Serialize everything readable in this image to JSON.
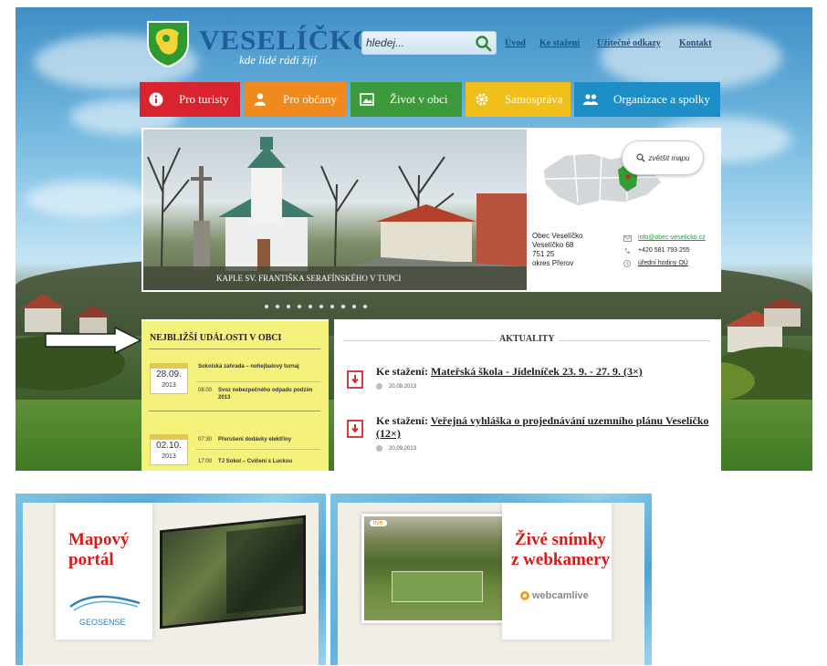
{
  "header": {
    "logo_title": "VESELÍČKO",
    "logo_slogan": "kde lidé rádi žijí",
    "search_placeholder": "hledej...",
    "top_links": [
      "Úvod",
      "Ke stažení",
      "Užitečné odkazy",
      "Kontakt"
    ]
  },
  "nav": {
    "tabs": [
      {
        "label": "Pro turisty",
        "color": "#d9232e",
        "icon": "info-icon"
      },
      {
        "label": "Pro občany",
        "color": "#f08a1c",
        "icon": "person-icon"
      },
      {
        "label": "Život v obci",
        "color": "#3c9a3c",
        "icon": "photo-icon"
      },
      {
        "label": "Samospráva",
        "color": "#f0bf1a",
        "icon": "gear-icon"
      },
      {
        "label": "Organizace a spolky",
        "color": "#1e8fc6",
        "icon": "group-icon"
      }
    ]
  },
  "slider": {
    "caption": "KAPLE SV. FRANTIŠKA SERAFÍNSKÉHO V TUPCI",
    "map_bubble": "zvětšit mapu",
    "address": [
      "Obec Veselíčko",
      "Veselíčko 68",
      "751 25",
      "okres Přerov"
    ],
    "contacts": [
      {
        "icon": "mail-icon",
        "text": "info@obec-veselicko.cz"
      },
      {
        "icon": "phone-icon",
        "text": "+420 581 793 255"
      },
      {
        "icon": "clock-icon",
        "text": "úřední hodiny OÚ"
      }
    ]
  },
  "events": {
    "title": "NEJBLIŽŠÍ UDÁLOSTI V OBCI",
    "days": [
      {
        "date": "28.09.",
        "year": "2013",
        "items": [
          {
            "time": "",
            "text": "Sokolská zahrada – nohejbalový turnaj"
          },
          {
            "time": "08:00",
            "text": "Svoz nebezpečného odpadu podzim 2013"
          }
        ]
      },
      {
        "date": "02.10.",
        "year": "2013",
        "items": [
          {
            "time": "07:30",
            "text": "Přerušení dodávky elektřiny"
          },
          {
            "time": "17:00",
            "text": "TJ Sokol – Cvičení s Luckou"
          }
        ]
      }
    ]
  },
  "news": {
    "title": "AKTUALITY",
    "items": [
      {
        "prefix": "Ke stažení:",
        "link": "Mateřská škola - Jídelníček 23. 9. - 27. 9. (3×)",
        "date": "20.09.2013"
      },
      {
        "prefix": "Ke stažení:",
        "link": "Veřejná vyhláška o projednávání uzemního plánu Veselíčko (12×)",
        "date": "20.09.2013"
      }
    ]
  },
  "banners": {
    "map_portal": {
      "title_line1": "Mapový",
      "title_line2": "portál",
      "brand": "GEOSENSE"
    },
    "webcam": {
      "title_line1": "Živé snímky",
      "title_line2": "z webkamery",
      "brand": "webcamlive",
      "badge": "live"
    }
  }
}
